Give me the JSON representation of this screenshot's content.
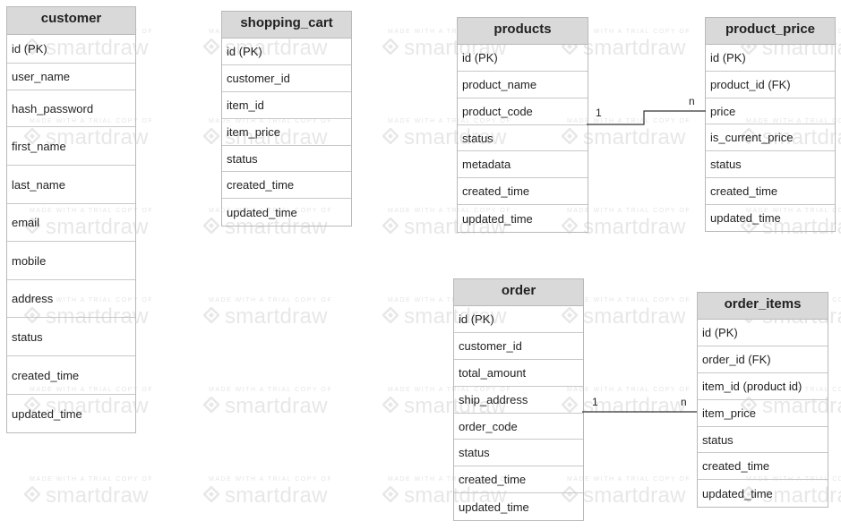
{
  "watermark": {
    "small_text": "MADE WITH A TRIAL COPY OF",
    "brand": "smartdraw",
    "logo_icon": "smartdraw-logo-icon"
  },
  "tables": {
    "customer": {
      "title": "customer",
      "fields": [
        "id (PK)",
        "user_name",
        "hash_password",
        "first_name",
        "last_name",
        "email",
        "mobile",
        "address",
        "status",
        "created_time",
        "updated_time"
      ]
    },
    "shopping_cart": {
      "title": "shopping_cart",
      "fields": [
        "id (PK)",
        "customer_id",
        "item_id",
        "item_price",
        "status",
        "created_time",
        "updated_time"
      ]
    },
    "products": {
      "title": "products",
      "fields": [
        "id (PK)",
        "product_name",
        "product_code",
        "status",
        "metadata",
        "created_time",
        "updated_time"
      ]
    },
    "product_price": {
      "title": "product_price",
      "fields": [
        "id (PK)",
        "product_id (FK)",
        "price",
        "is_current_price",
        "status",
        "created_time",
        "updated_time"
      ]
    },
    "order": {
      "title": "order",
      "fields": [
        "id (PK)",
        "customer_id",
        "total_amount",
        "ship_address",
        "order_code",
        "status",
        "created_time",
        "updated_time"
      ]
    },
    "order_items": {
      "title": "order_items",
      "fields": [
        "id (PK)",
        "order_id (FK)",
        "item_id (product id)",
        "item_price",
        "status",
        "created_time",
        "updated_time"
      ]
    }
  },
  "relations": {
    "products_to_product_price": {
      "from_card": "1",
      "to_card": "n"
    },
    "order_to_order_items": {
      "from_card": "1",
      "to_card": "n"
    }
  }
}
